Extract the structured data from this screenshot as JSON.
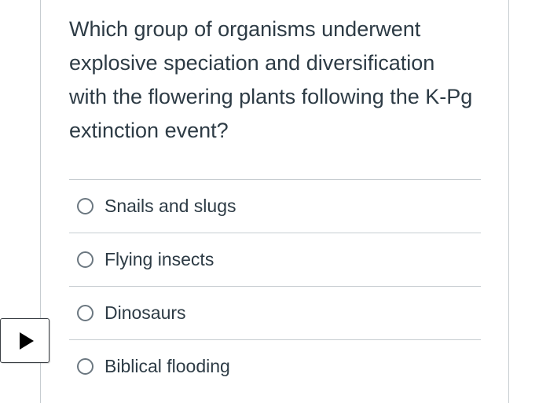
{
  "question": {
    "text": "Which group of organisms underwent explosive speciation and diversification with the flowering plants following the K-Pg extinction event?"
  },
  "answers": [
    {
      "label": "Snails and slugs",
      "selected": false
    },
    {
      "label": "Flying insects",
      "selected": false
    },
    {
      "label": "Dinosaurs",
      "selected": false
    },
    {
      "label": "Biblical flooding",
      "selected": false
    }
  ],
  "icons": {
    "nav_toggle": "play-icon"
  }
}
